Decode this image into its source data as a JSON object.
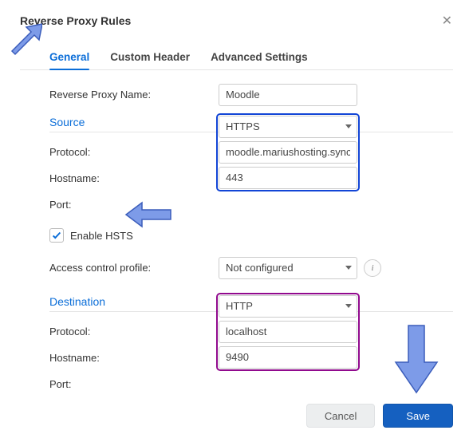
{
  "dialog": {
    "title": "Reverse Proxy Rules"
  },
  "tabs": {
    "general": "General",
    "custom_header": "Custom Header",
    "advanced": "Advanced Settings"
  },
  "fields": {
    "name_label": "Reverse Proxy Name:",
    "name_value": "Moodle"
  },
  "source": {
    "title": "Source",
    "protocol_label": "Protocol:",
    "protocol_value": "HTTPS",
    "hostname_label": "Hostname:",
    "hostname_value": "moodle.mariushosting.sync",
    "port_label": "Port:",
    "port_value": "443",
    "enable_hsts_label": "Enable HSTS",
    "acp_label": "Access control profile:",
    "acp_value": "Not configured"
  },
  "destination": {
    "title": "Destination",
    "protocol_label": "Protocol:",
    "protocol_value": "HTTP",
    "hostname_label": "Hostname:",
    "hostname_value": "localhost",
    "port_label": "Port:",
    "port_value": "9490"
  },
  "footer": {
    "cancel": "Cancel",
    "save": "Save"
  }
}
